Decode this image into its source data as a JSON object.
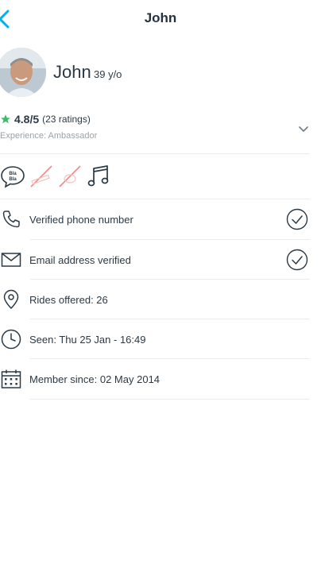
{
  "header": {
    "title": "John"
  },
  "profile": {
    "name": "John",
    "age": "39 y/o"
  },
  "rating": {
    "score": "4.8/5",
    "count": "(23 ratings)",
    "experience": "Experience: Ambassador"
  },
  "info_rows": [
    {
      "label": "Verified phone number",
      "icon": "phone-icon",
      "verified": true
    },
    {
      "label": "Email address verified",
      "icon": "envelope-icon",
      "verified": true
    },
    {
      "label": "Rides offered: 26",
      "icon": "location-pin-icon",
      "verified": false
    },
    {
      "label": "Seen: Thu 25 Jan - 16:49",
      "icon": "clock-icon",
      "verified": false
    },
    {
      "label": "Member since: 02 May 2014",
      "icon": "calendar-icon",
      "verified": false
    }
  ],
  "colors": {
    "accent": "#00aff5",
    "star": "#3fba6a",
    "text": "#2b3946",
    "muted": "#9aa3aa",
    "divider": "#e8ecef",
    "cross": "#f08a8a"
  }
}
